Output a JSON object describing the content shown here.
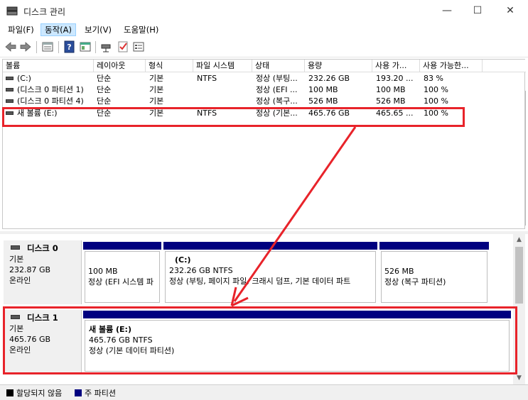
{
  "window": {
    "title": "디스크 관리",
    "minimize_glyph": "—",
    "maximize_glyph": "☐",
    "close_glyph": "✕"
  },
  "menu": [
    "파일(F)",
    "동작(A)",
    "보기(V)",
    "도움말(H)"
  ],
  "toolbar_icons": [
    "back-arrow-icon",
    "forward-arrow-icon",
    "list-view-icon",
    "help-icon",
    "properties-icon",
    "disk-connect-icon",
    "check-icon",
    "settings-panel-icon"
  ],
  "volume_table": {
    "headers": [
      "볼륨",
      "레이아웃",
      "형식",
      "파일 시스템",
      "상태",
      "용량",
      "사용 가...",
      "사용 가능한..."
    ],
    "rows": [
      [
        "(C:)",
        "단순",
        "기본",
        "NTFS",
        "정상 (부팅...",
        "232.26 GB",
        "193.20 ...",
        "83 %"
      ],
      [
        "(디스크 0 파티션 1)",
        "단순",
        "기본",
        "",
        "정상 (EFI ...",
        "100 MB",
        "100 MB",
        "100 %"
      ],
      [
        "(디스크 0 파티션 4)",
        "단순",
        "기본",
        "",
        "정상 (복구...",
        "526 MB",
        "526 MB",
        "100 %"
      ],
      [
        "새 볼륨 (E:)",
        "단순",
        "기본",
        "NTFS",
        "정상 (기본...",
        "465.76 GB",
        "465.65 ...",
        "100 %"
      ]
    ]
  },
  "disks": [
    {
      "name": "디스크 0",
      "type": "기본",
      "size": "232.87 GB",
      "status": "온라인",
      "partitions": [
        {
          "title": "",
          "size": "100 MB",
          "status": "정상 (EFI 시스템 파"
        },
        {
          "title": "(C:)",
          "size": "232.26 GB NTFS",
          "status": "정상 (부팅, 페이지 파일, 크래시 덤프, 기본 데이터 파트"
        },
        {
          "title": "",
          "size": "526 MB",
          "status": "정상 (복구 파티션)"
        }
      ]
    },
    {
      "name": "디스크 1",
      "type": "기본",
      "size": "465.76 GB",
      "status": "온라인",
      "partitions": [
        {
          "title": "새 볼륨  (E:)",
          "size": "465.76 GB NTFS",
          "status": "정상 (기본 데이터 파티션)"
        }
      ]
    }
  ],
  "legend": [
    {
      "label": "할당되지 않음",
      "color": "#000000"
    },
    {
      "label": "주 파티션",
      "color": "#00007f"
    }
  ],
  "colors": {
    "primary_partition": "#00007f",
    "highlight": "#e8232a",
    "menu_active": "#cce8ff"
  }
}
